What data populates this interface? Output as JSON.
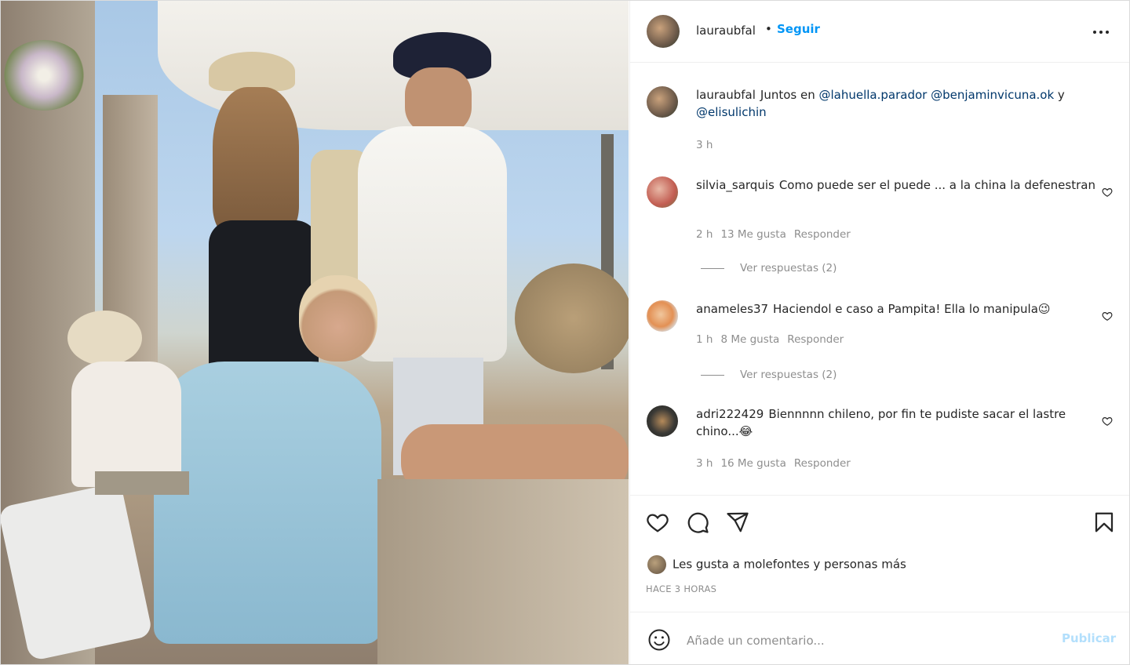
{
  "post": {
    "username": "lauraubfal",
    "follow_label": "Seguir",
    "dot": "•"
  },
  "caption": {
    "username": "lauraubfal",
    "text_before": "Juntos en ",
    "mention1": "@lahuella.parador",
    "mention2": "@benjaminvicuna.ok",
    "text_and": " y ",
    "mention3": "@elisulichin",
    "time": "3 h"
  },
  "comments": [
    {
      "username": "silvia_sarquis",
      "text": "Como puede ser el puede ... a la china la defenestran",
      "time": "2 h",
      "likes": "13 Me gusta",
      "reply_label": "Responder",
      "view_replies": "Ver respuestas (2)"
    },
    {
      "username": "anameles37",
      "text": "Haciendol e caso a Pampita! Ella lo manipula😉",
      "time": "1 h",
      "likes": "8 Me gusta",
      "reply_label": "Responder",
      "view_replies": "Ver respuestas (2)"
    },
    {
      "username": "adri222429",
      "text": "Biennnnn chileno, por fin te pudiste sacar el lastre chino...😂",
      "time": "3 h",
      "likes": "16 Me gusta",
      "reply_label": "Responder"
    }
  ],
  "likes_summary": {
    "prefix": "Les gusta a ",
    "user": "molefontes",
    "suffix": " y personas más"
  },
  "post_time": "HACE 3 HORAS",
  "add_comment": {
    "placeholder": "Añade un comentario...",
    "publish_label": "Publicar"
  },
  "colors": {
    "link": "#0095f6",
    "mention": "#00376b",
    "muted": "#8e8e8e",
    "publish_disabled": "#b2dffc"
  },
  "icons": [
    "more-icon",
    "heart-icon",
    "comment-icon",
    "share-icon",
    "bookmark-icon",
    "emoji-icon"
  ]
}
